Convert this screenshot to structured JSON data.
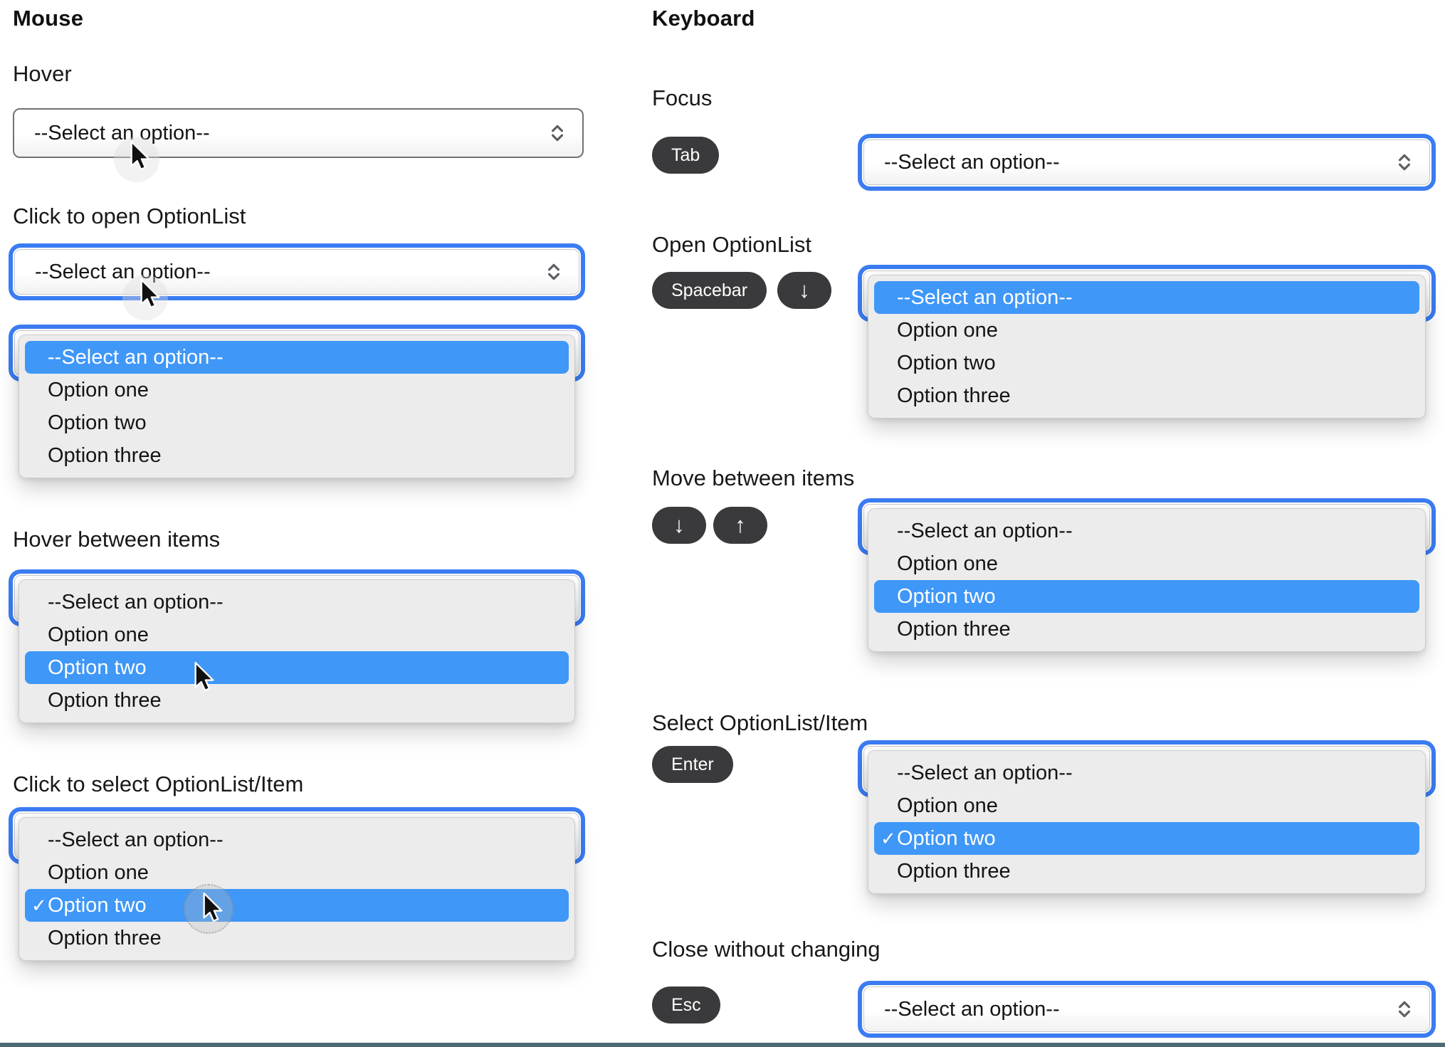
{
  "options": [
    "--Select an option--",
    "Option one",
    "Option two",
    "Option three"
  ],
  "placeholder": "--Select an option--",
  "check_glyph": "✓",
  "colors": {
    "highlight_blue": "#3f97f7",
    "focus_ring_blue": "#3b7cf2",
    "key_background": "#3a3a3c",
    "panel_background": "#ececec",
    "bottom_bar": "#4c6b74"
  },
  "mouse": {
    "title": "Mouse",
    "hover": {
      "label": "Hover"
    },
    "click_open": {
      "label": "Click to open OptionList"
    },
    "hover_items": {
      "label": "Hover between items"
    },
    "click_select": {
      "label": "Click to select OptionList/Item"
    }
  },
  "keyboard": {
    "title": "Keyboard",
    "focus": {
      "label": "Focus",
      "keys": [
        "Tab"
      ]
    },
    "open": {
      "label": "Open OptionList",
      "keys": [
        "Spacebar",
        "↓"
      ]
    },
    "move": {
      "label": "Move between items",
      "keys": [
        "↓",
        "↑"
      ]
    },
    "select": {
      "label": "Select OptionList/Item",
      "keys": [
        "Enter"
      ]
    },
    "close": {
      "label": "Close without changing",
      "keys": [
        "Esc"
      ]
    }
  }
}
